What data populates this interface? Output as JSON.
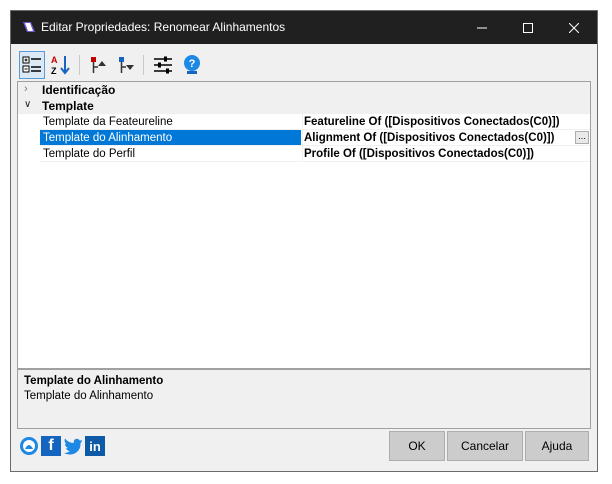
{
  "window": {
    "title": "Editar Propriedades: Renomear Alinhamentos"
  },
  "toolbar": {
    "icons": [
      "categorized-icon",
      "alphabetical-sort-icon",
      "move-up-icon",
      "move-down-icon",
      "settings-sliders-icon",
      "help-icon"
    ]
  },
  "categories": [
    {
      "label": "Identificação",
      "expanded": false
    },
    {
      "label": "Template",
      "expanded": true
    }
  ],
  "properties": [
    {
      "name": "Template da Feateureline",
      "value": "Featureline Of ([Dispositivos Conectados(C0)])"
    },
    {
      "name": "Template do Alinhamento",
      "value": "Alignment Of ([Dispositivos Conectados(C0)])",
      "selected": true,
      "ellipsis": "..."
    },
    {
      "name": "Template do Perfil",
      "value": "Profile Of ([Dispositivos Conectados(C0)])"
    }
  ],
  "description": {
    "title": "Template do Alinhamento",
    "body": "Template do Alinhamento"
  },
  "buttons": {
    "ok": "OK",
    "cancel": "Cancelar",
    "help": "Ajuda"
  },
  "social": {
    "facebook": "f",
    "linkedin": "in"
  },
  "colors": {
    "titlebar": "#202020",
    "selection": "#0078d7"
  }
}
